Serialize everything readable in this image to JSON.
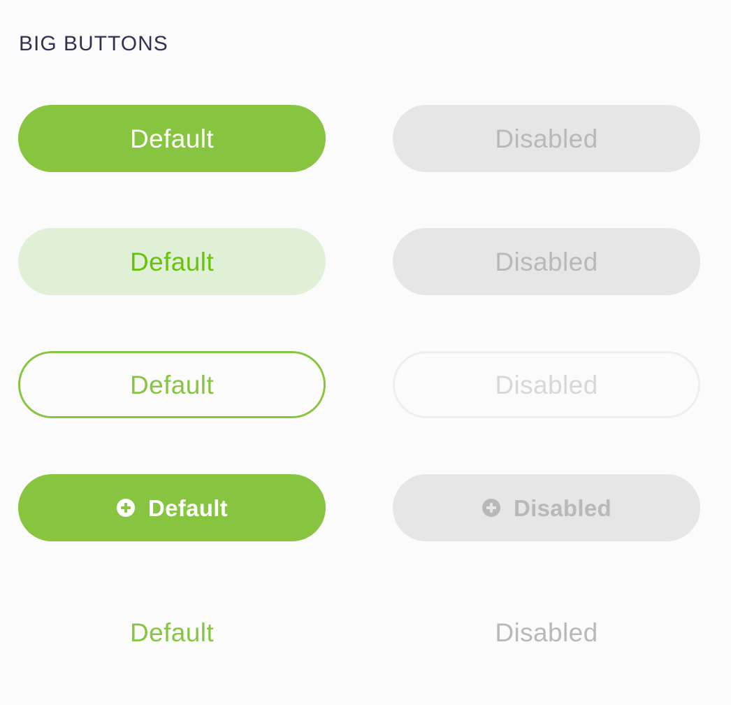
{
  "section": {
    "title": "BIG BUTTONS"
  },
  "buttons": {
    "row1": {
      "default_label": "Default",
      "disabled_label": "Disabled"
    },
    "row2": {
      "default_label": "Default",
      "disabled_label": "Disabled"
    },
    "row3": {
      "default_label": "Default",
      "disabled_label": "Disabled"
    },
    "row4": {
      "default_label": "Default",
      "disabled_label": "Disabled",
      "icon": "plus-circle-icon"
    },
    "row5": {
      "default_label": "Default",
      "disabled_label": "Disabled"
    }
  },
  "colors": {
    "primary": "#87c541",
    "primary_soft": "#e0f0d6",
    "soft_text": "#68c20a",
    "disabled_fill": "#e6e6e6",
    "disabled_text": "#b8b8b8",
    "outline_disabled_border": "#eeeeee",
    "outline_disabled_text": "#d7d7d7",
    "title": "#34304f",
    "background": "#fbfbfb"
  }
}
